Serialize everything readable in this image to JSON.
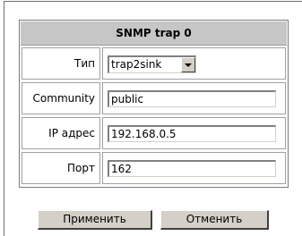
{
  "panel": {
    "title": "SNMP trap 0"
  },
  "fields": {
    "type": {
      "label": "Тип",
      "value": "trap2sink"
    },
    "community": {
      "label": "Community",
      "value": "public"
    },
    "ip": {
      "label": "IP адрес",
      "value": "192.168.0.5"
    },
    "port": {
      "label": "Порт",
      "value": "162"
    }
  },
  "buttons": {
    "apply": "Применить",
    "cancel": "Отменить"
  },
  "icons": {
    "select_arrow": "chevron-down-icon"
  }
}
